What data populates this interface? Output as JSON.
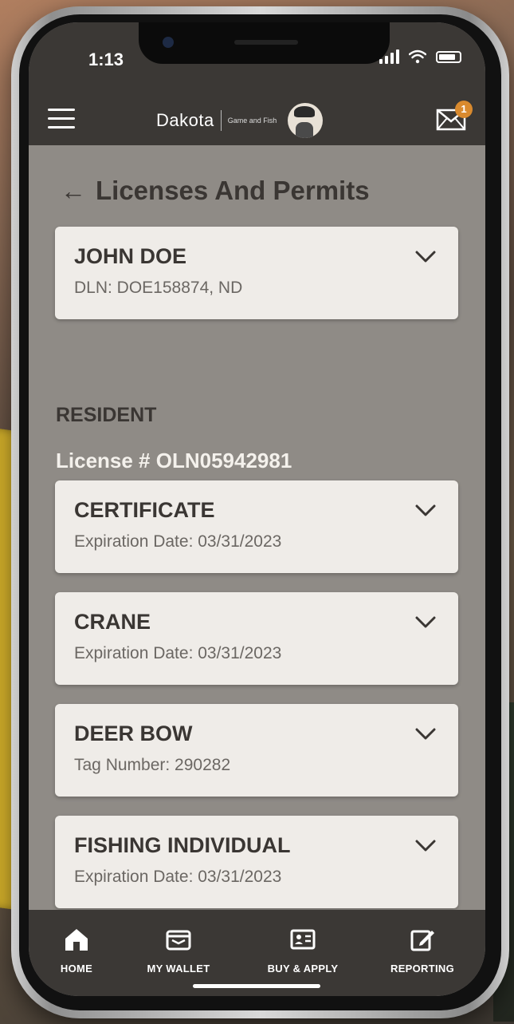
{
  "status_bar": {
    "time": "1:13"
  },
  "header": {
    "logo_state": "Dakota",
    "logo_agency": "Game and Fish",
    "mail_badge_count": "1"
  },
  "page": {
    "title": "Licenses And Permits"
  },
  "customer_card": {
    "name": "JOHN DOE",
    "dln": "DLN: DOE158874, ND"
  },
  "resident": {
    "label": "RESIDENT",
    "license_number": "License # OLN05942981"
  },
  "licenses": [
    {
      "title": "CERTIFICATE",
      "detail": "Expiration Date: 03/31/2023"
    },
    {
      "title": "CRANE",
      "detail": "Expiration Date: 03/31/2023"
    },
    {
      "title": "DEER BOW",
      "detail": "Tag Number: 290282"
    },
    {
      "title": "FISHING INDIVIDUAL",
      "detail": "Expiration Date: 03/31/2023"
    }
  ],
  "tabbar": {
    "home": "HOME",
    "wallet": "MY WALLET",
    "buy_apply": "BUY & APPLY",
    "reporting": "REPORTING"
  },
  "colors": {
    "header_bg": "#3b3835",
    "content_bg": "#8f8b86",
    "card_bg": "#efece8",
    "badge": "#d98a2e"
  }
}
